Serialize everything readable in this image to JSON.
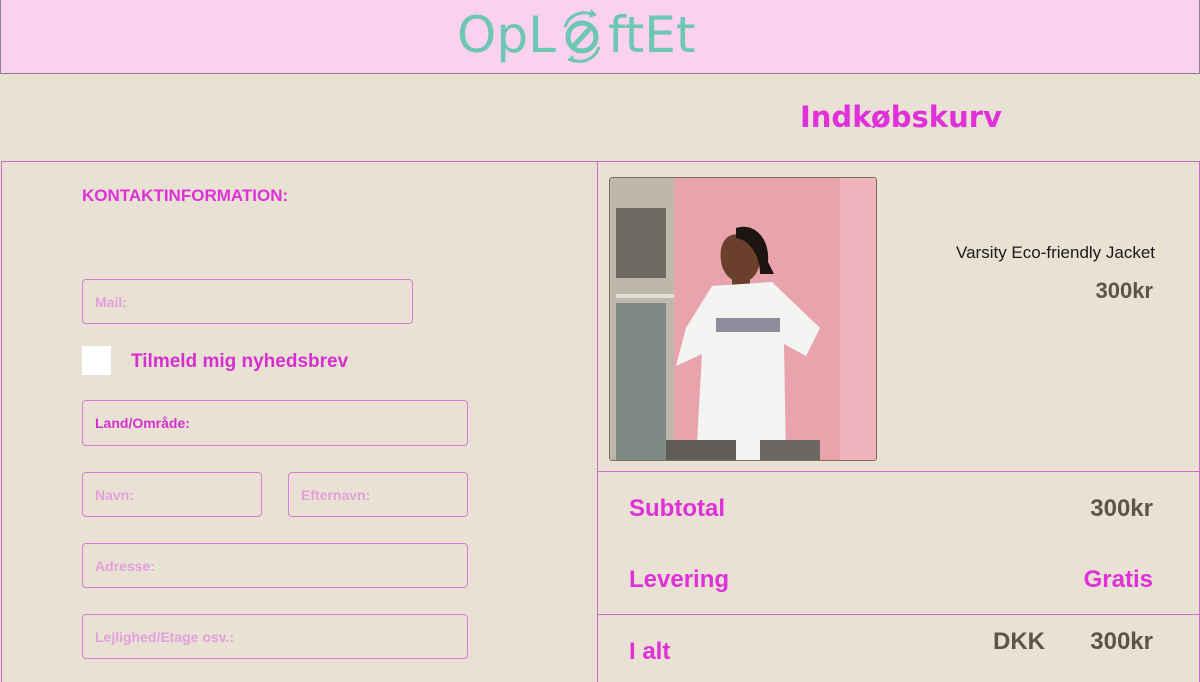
{
  "header": {
    "logo_text": "OpLøftEt",
    "logo_parts": {
      "before": "OpL",
      "after": "ftEt"
    },
    "logo_icon": "recycle-arrows-icon",
    "background": "#fad1ee",
    "logo_color": "#6cc7b3"
  },
  "page": {
    "title": "Indkøbskurv",
    "background": "#e8e1d4",
    "accent": "#df30d9"
  },
  "contact": {
    "section_title": "KONTAKTINFORMATION:",
    "mail_placeholder": "Mail:",
    "newsletter_label": "Tilmeld mig nyhedsbrev",
    "newsletter_checked": false,
    "country_placeholder": "Land/Område:",
    "first_name_placeholder": "Navn:",
    "last_name_placeholder": "Efternavn:",
    "address_placeholder": "Adresse:",
    "apartment_placeholder": "Lejlighed/Etage osv.:"
  },
  "cart": {
    "product": {
      "name": "Varsity Eco-friendly Jacket",
      "price": "300kr"
    },
    "subtotal_label": "Subtotal",
    "subtotal_value": "300kr",
    "shipping_label": "Levering",
    "shipping_value": "Gratis",
    "total_label": "I alt",
    "total_currency": "DKK",
    "total_value": "300kr"
  }
}
